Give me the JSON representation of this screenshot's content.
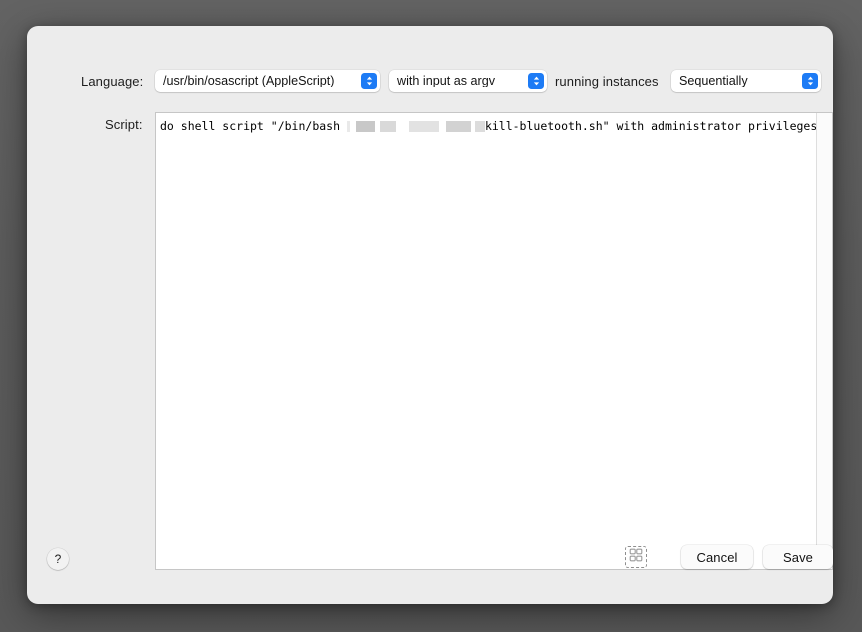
{
  "dialog": {
    "language_label": "Language:",
    "script_label": "Script:",
    "running_instances_label": "running instances"
  },
  "popups": {
    "language": {
      "name": "language-popup",
      "value": "/usr/bin/osascript (AppleScript)",
      "icon": "updown-chevron-icon"
    },
    "input": {
      "name": "input-mode-popup",
      "value": "with input as argv",
      "icon": "updown-chevron-icon"
    },
    "instances": {
      "name": "running-instances-popup",
      "value": "Sequentially",
      "icon": "updown-chevron-icon"
    }
  },
  "script": {
    "prefix": "do shell script \"/bin/bash ",
    "suffix": "kill-bluetooth.sh\" with administrator privileges",
    "redaction_blocks": [
      {
        "width": 3,
        "color": "#e9e9e9"
      },
      {
        "width": 6,
        "color": "#ffffff"
      },
      {
        "width": 19,
        "color": "#c8c8c8"
      },
      {
        "width": 5,
        "color": "#ffffff"
      },
      {
        "width": 16,
        "color": "#d9d9d9"
      },
      {
        "width": 13,
        "color": "#ffffff"
      },
      {
        "width": 30,
        "color": "#e2e2e2"
      },
      {
        "width": 7,
        "color": "#ffffff"
      },
      {
        "width": 25,
        "color": "#d2d2d2"
      },
      {
        "width": 4,
        "color": "#ffffff"
      },
      {
        "width": 10,
        "color": "#dcdcdc"
      }
    ]
  },
  "buttons": {
    "help": {
      "label": "?",
      "name": "help-button"
    },
    "grid_toggle": {
      "name": "grid-toggle-button",
      "icon": "grid-2x2-icon"
    },
    "cancel": {
      "label": "Cancel",
      "name": "cancel-button"
    },
    "save": {
      "label": "Save",
      "name": "save-button"
    }
  },
  "colors": {
    "accent": "#1d7bf5",
    "dialog_background": "#ececec",
    "editor_background": "#ffffff",
    "desktop_background": "#5f5f5f"
  }
}
